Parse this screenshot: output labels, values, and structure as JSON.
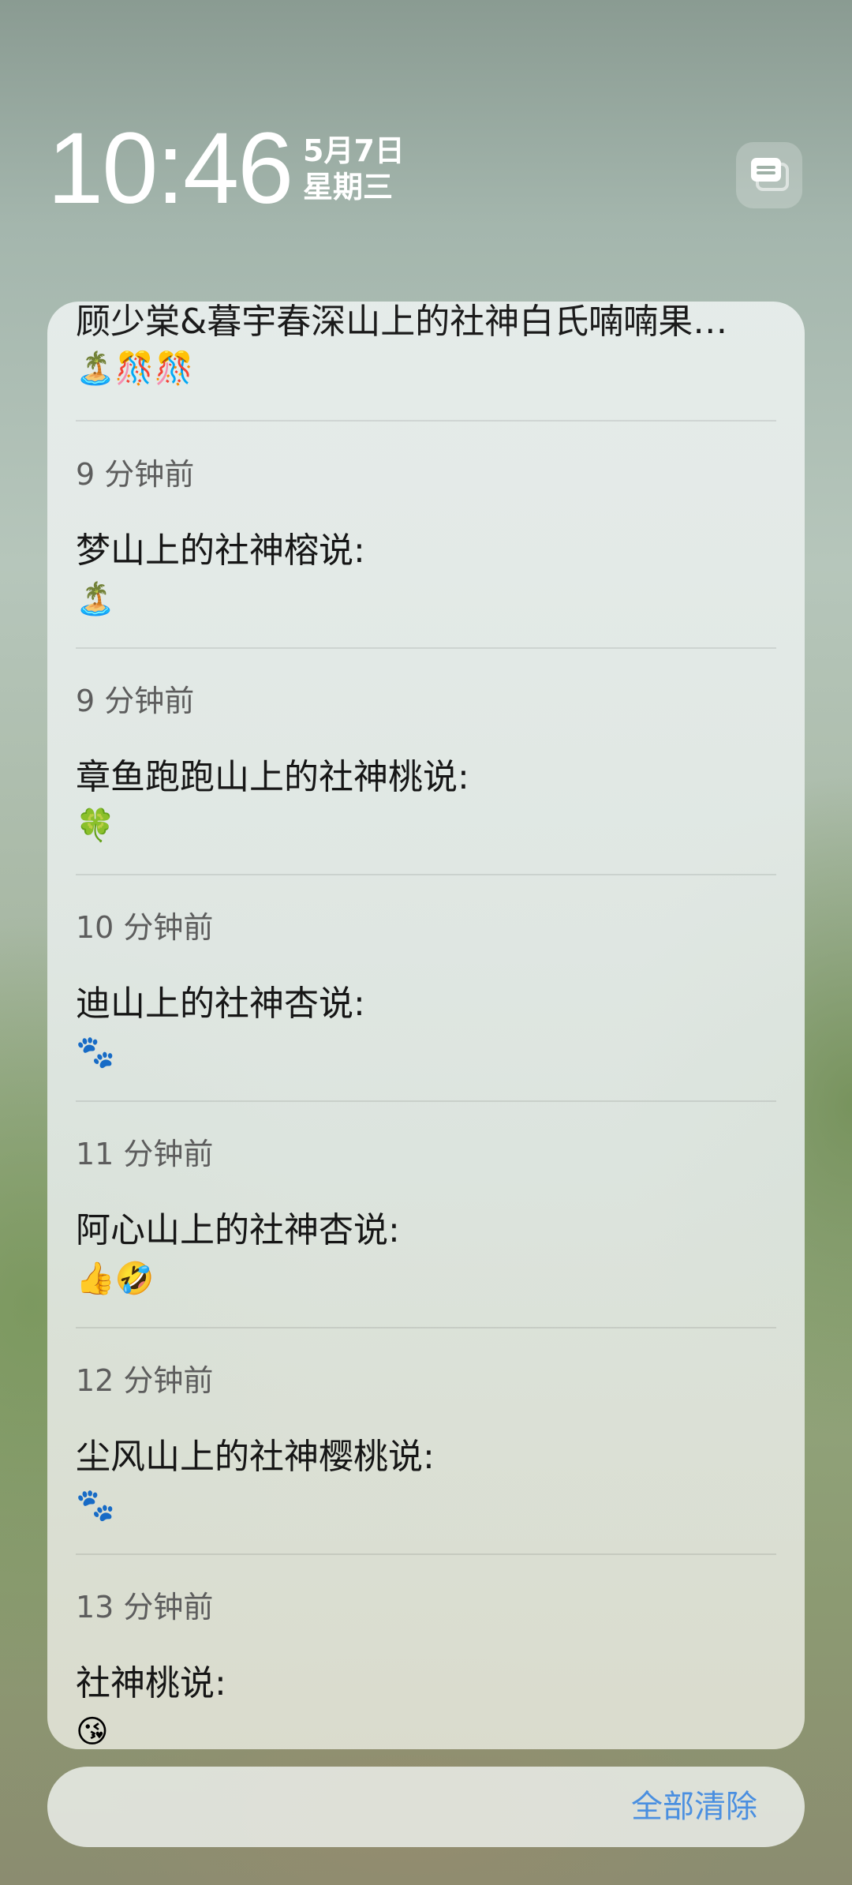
{
  "lockscreen": {
    "time": "10:46",
    "date": "5月7日",
    "weekday": "星期三"
  },
  "notifications": {
    "first": {
      "title": "顾少棠&暮宇春深山上的社神白氏喃喃果…",
      "message": "🏝️🎊🎊"
    },
    "items": [
      {
        "time": "9 分钟前",
        "sender": "梦山上的社神榕说:",
        "message": "🏝️"
      },
      {
        "time": "9 分钟前",
        "sender": "章鱼跑跑山上的社神桃说:",
        "message": "🍀"
      },
      {
        "time": "10 分钟前",
        "sender": "迪山上的社神杏说:",
        "message": "🐾"
      },
      {
        "time": "11 分钟前",
        "sender": "阿心山上的社神杏说:",
        "message": "👍🤣"
      },
      {
        "time": "12 分钟前",
        "sender": "尘风山上的社神樱桃说:",
        "message": "🐾"
      },
      {
        "time": "13 分钟前",
        "sender": "社神桃说:",
        "message": "😘"
      }
    ],
    "clear_all_label": "全部清除"
  },
  "colors": {
    "accent": "#4a8fe0",
    "card_bg": "#e6ece9",
    "text_primary": "#161616",
    "text_secondary": "#5d5d5d"
  },
  "icons": {
    "group_toggle": "stacked-cards-icon"
  }
}
